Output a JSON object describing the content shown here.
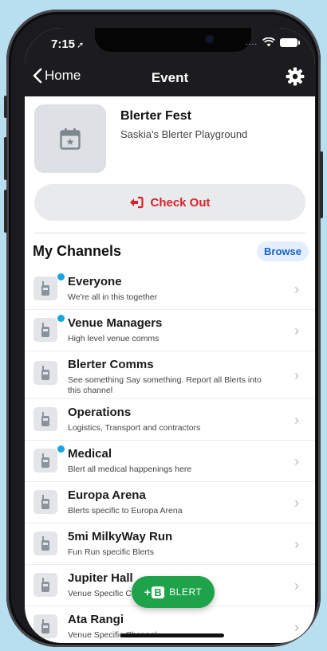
{
  "status": {
    "time": "7:15",
    "signal_dots": "...."
  },
  "nav": {
    "back_label": "Home",
    "title": "Event"
  },
  "event": {
    "title": "Blerter Fest",
    "subtitle": "Saskia's Blerter Playground"
  },
  "checkout": {
    "label": "Check Out"
  },
  "channels_section": {
    "title": "My Channels",
    "browse_label": "Browse"
  },
  "channels": [
    {
      "name": "Everyone",
      "desc": "We're all in this together",
      "unread": true
    },
    {
      "name": "Venue Managers",
      "desc": "High level venue comms",
      "unread": true
    },
    {
      "name": "Blerter Comms",
      "desc": "See something Say something. Report all Blerts into this channel",
      "unread": false
    },
    {
      "name": "Operations",
      "desc": "Logistics, Transport and contractors",
      "unread": false
    },
    {
      "name": "Medical",
      "desc": "Blert all medical happenings here",
      "unread": true
    },
    {
      "name": "Europa Arena",
      "desc": "Blerts specific to Europa Arena",
      "unread": false
    },
    {
      "name": "5mi MilkyWay Run",
      "desc": "Fun Run specific Blerts",
      "unread": false
    },
    {
      "name": "Jupiter Hall",
      "desc": "Venue Specific Channel",
      "unread": false
    },
    {
      "name": "Ata Rangi",
      "desc": "Venue Specific Channel",
      "unread": false
    }
  ],
  "fab": {
    "plus": "+",
    "logo_letter": "B",
    "label": "BLERT"
  },
  "colors": {
    "accent_blue": "#1463c7",
    "checkout_red": "#d9212c",
    "unread_dot": "#1aa5e0",
    "fab_green": "#1fa34a"
  }
}
